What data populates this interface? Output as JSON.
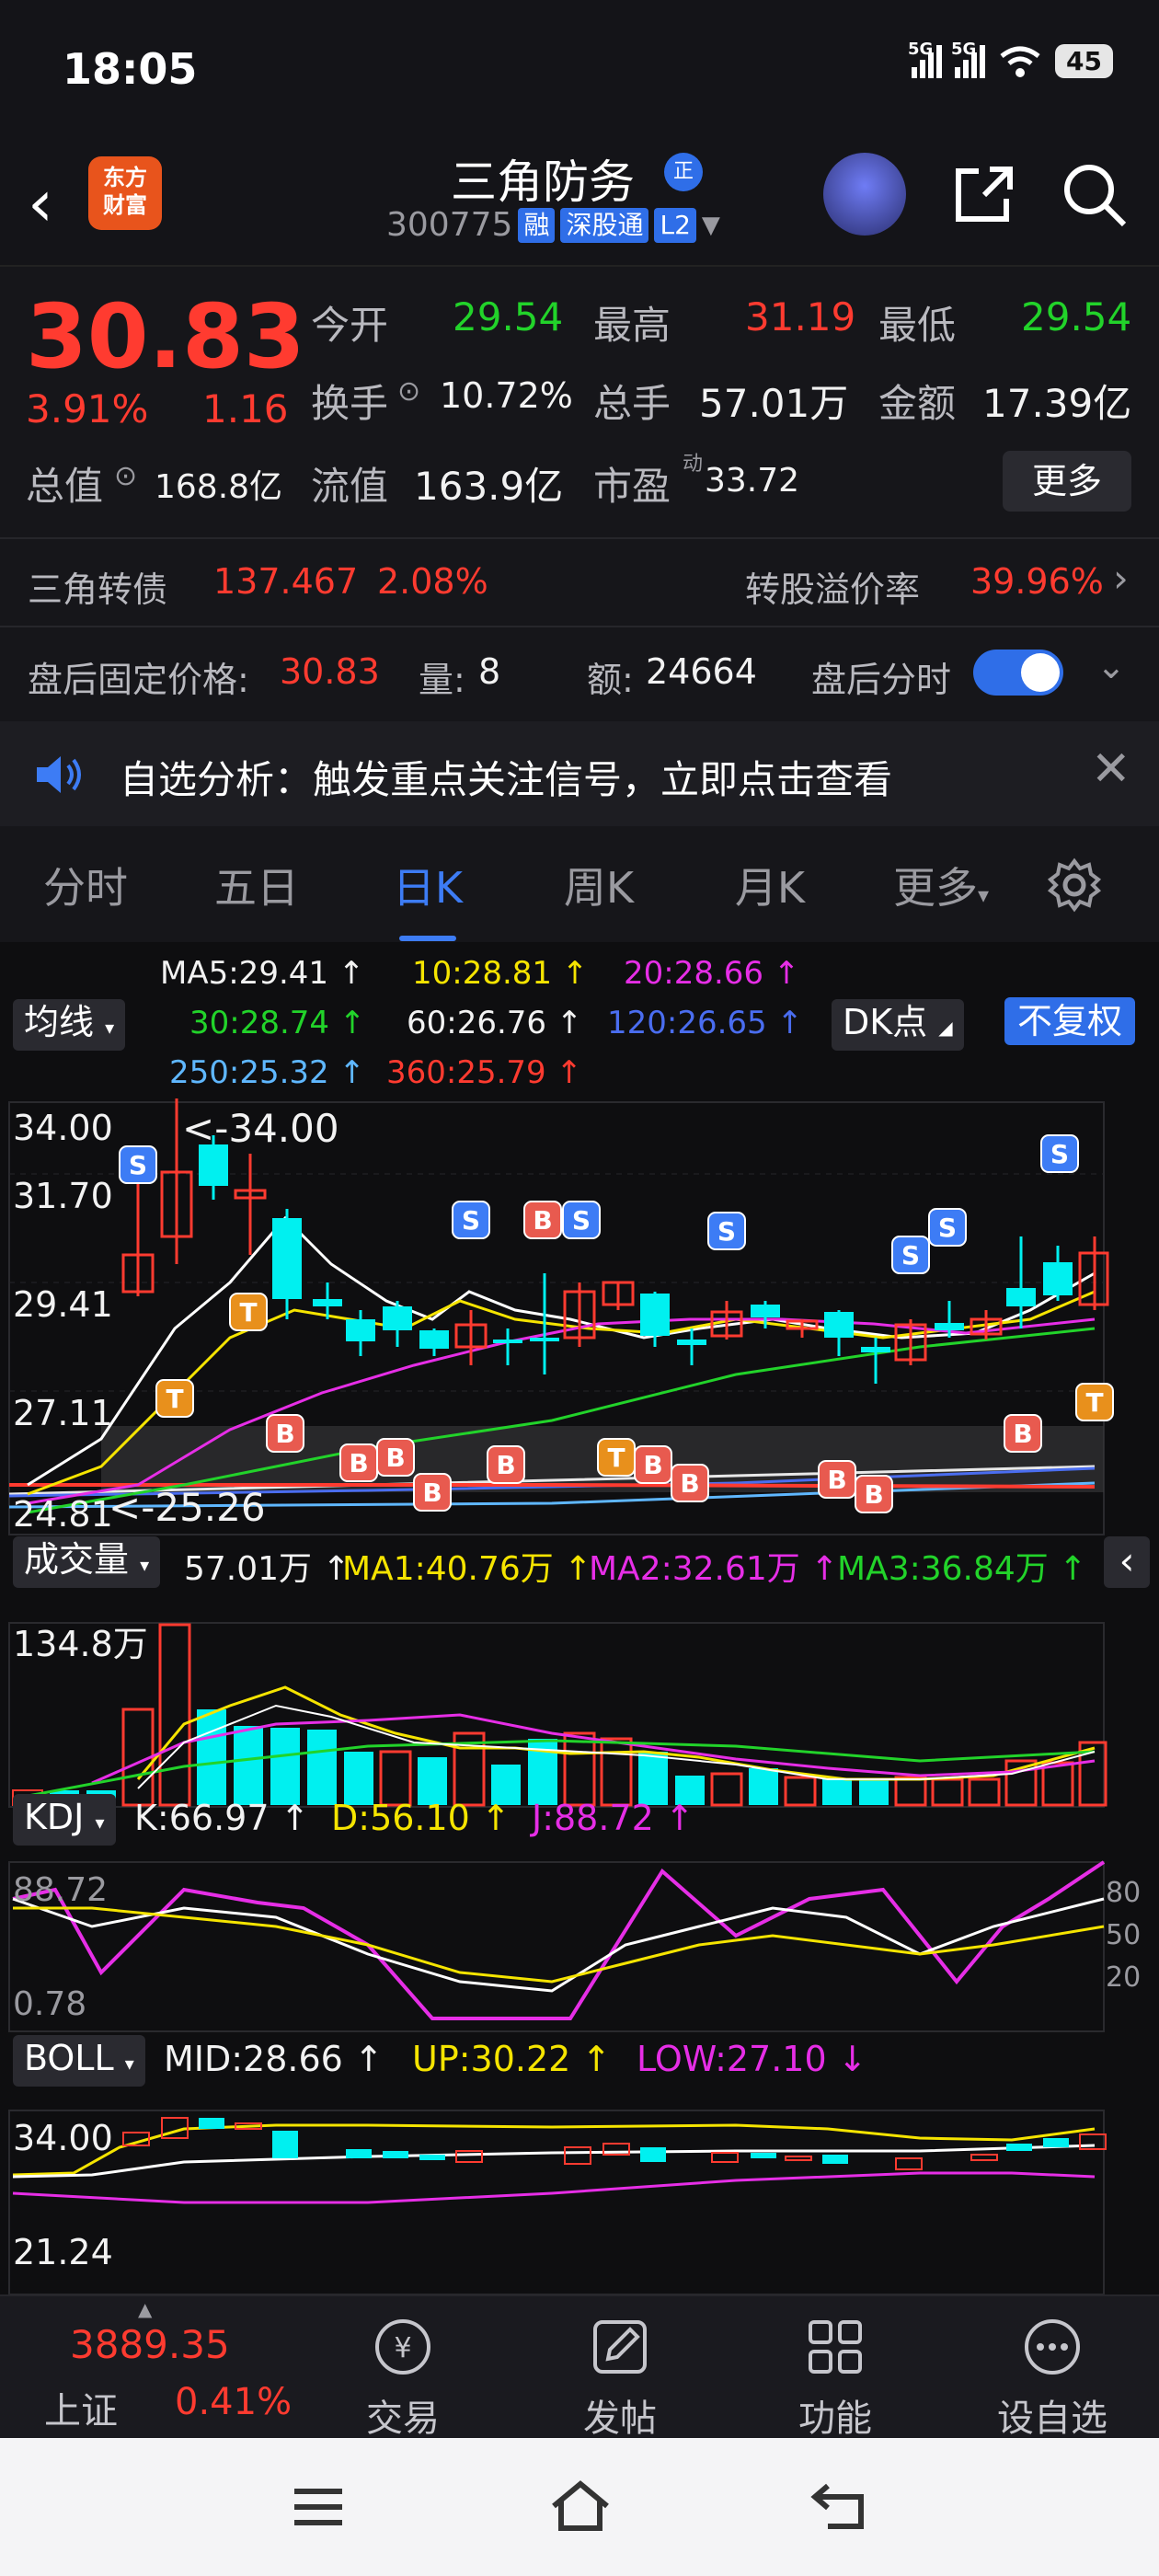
{
  "status_bar": {
    "time": "18:05",
    "net1": "5G",
    "net2": "5G",
    "battery": "45"
  },
  "header": {
    "title": "三角防务",
    "badge": "正",
    "code": "300775",
    "tags": [
      "融",
      "深股通",
      "L2"
    ],
    "logo_text_1": "东方",
    "logo_text_2": "财富"
  },
  "quote": {
    "price": "30.83",
    "change_pct": "3.91%",
    "change": "1.16",
    "open_label": "今开",
    "open": "29.54",
    "high_label": "最高",
    "high": "31.19",
    "low_label": "最低",
    "low": "29.54",
    "turnover_label": "换手",
    "turnover": "10.72%",
    "volume_label": "总手",
    "volume": "57.01万",
    "amount_label": "金额",
    "amount": "17.39亿",
    "mktcap_label": "总值",
    "mktcap": "168.8亿",
    "float_label": "流值",
    "float": "163.9亿",
    "pe_label": "市盈",
    "pe_sup": "动",
    "pe": "33.72",
    "more": "更多"
  },
  "bond": {
    "name": "三角转债",
    "price": "137.467",
    "pct": "2.08%",
    "premium_label": "转股溢价率",
    "premium": "39.96%"
  },
  "after_hours": {
    "price_label": "盘后固定价格:",
    "price": "30.83",
    "qty_label": "量:",
    "qty": "8",
    "amt_label": "额:",
    "amt": "24664",
    "toggle_label": "盘后分时"
  },
  "notice": {
    "text": "自选分析：触发重点关注信号，立即点击查看"
  },
  "tabs": [
    "分时",
    "五日",
    "日K",
    "周K",
    "月K",
    "更多"
  ],
  "ma": {
    "selector": "均线",
    "ma5": "MA5:29.41",
    "ma10": "10:28.81",
    "ma20": "20:28.66",
    "ma30": "30:28.74",
    "ma60": "60:26.76",
    "ma120": "120:26.65",
    "ma250": "250:25.32",
    "ma360": "360:25.79",
    "dk": "DK点",
    "fq": "不复权"
  },
  "kline": {
    "y_high": "34.00",
    "y2": "31.70",
    "y3": "29.41",
    "y4": "27.11",
    "y_low": "24.81",
    "max_label": "<-34.00",
    "min_label": "<-25.26"
  },
  "volume": {
    "selector": "成交量",
    "value": "57.01万",
    "ma1": "MA1:40.76万",
    "ma2": "MA2:32.61万",
    "ma3": "MA3:36.84万",
    "y_max": "134.8万"
  },
  "kdj": {
    "selector": "KDJ",
    "k": "K:66.97",
    "d": "D:56.10",
    "j": "J:88.72",
    "y_top": "88.72",
    "y_bot": "0.78",
    "r80": "80",
    "r50": "50",
    "r20": "20"
  },
  "boll": {
    "selector": "BOLL",
    "mid": "MID:28.66",
    "up": "UP:30.22",
    "low": "LOW:27.10",
    "y_top": "34.00",
    "y_bot": "21.24"
  },
  "bottom_nav": {
    "index_value": "3889.35",
    "index_name": "上证",
    "index_pct": "0.41%",
    "trade": "交易",
    "post": "发帖",
    "func": "功能",
    "watch": "设自选"
  },
  "colors": {
    "up": "#ff3b30",
    "down": "#22d32a",
    "accent": "#3d7cf5",
    "candle_down": "#00f0f0"
  }
}
